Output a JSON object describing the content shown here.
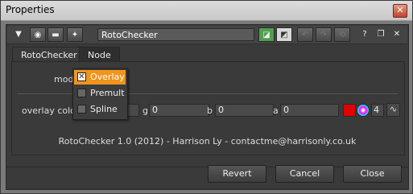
{
  "window": {
    "title": "Properties",
    "close_label": "✕"
  },
  "toolbar": {
    "node_name": "RotoChecker",
    "right_icons": [
      "?",
      "❐",
      "✕"
    ]
  },
  "tabs": [
    {
      "label": "RotoChecker",
      "active": true
    },
    {
      "label": "Node",
      "active": false
    }
  ],
  "mode": {
    "label": "mode",
    "options": [
      {
        "label": "Overlay",
        "selected": true
      },
      {
        "label": "Premult",
        "selected": false
      },
      {
        "label": "Spline",
        "selected": false
      }
    ]
  },
  "overlay_color": {
    "label": "overlay color",
    "g_label": "g",
    "g_value": "0",
    "b_label": "b",
    "b_value": "0",
    "a_label": "a",
    "a_value": "0",
    "swatch_color": "#e00000",
    "channel_count": "4"
  },
  "credit": "RotoChecker 1.0 (2012) - Harrison Ly - contactme@harrisonly.co.uk",
  "buttons": {
    "revert": "Revert",
    "cancel": "Cancel",
    "close": "Close"
  }
}
